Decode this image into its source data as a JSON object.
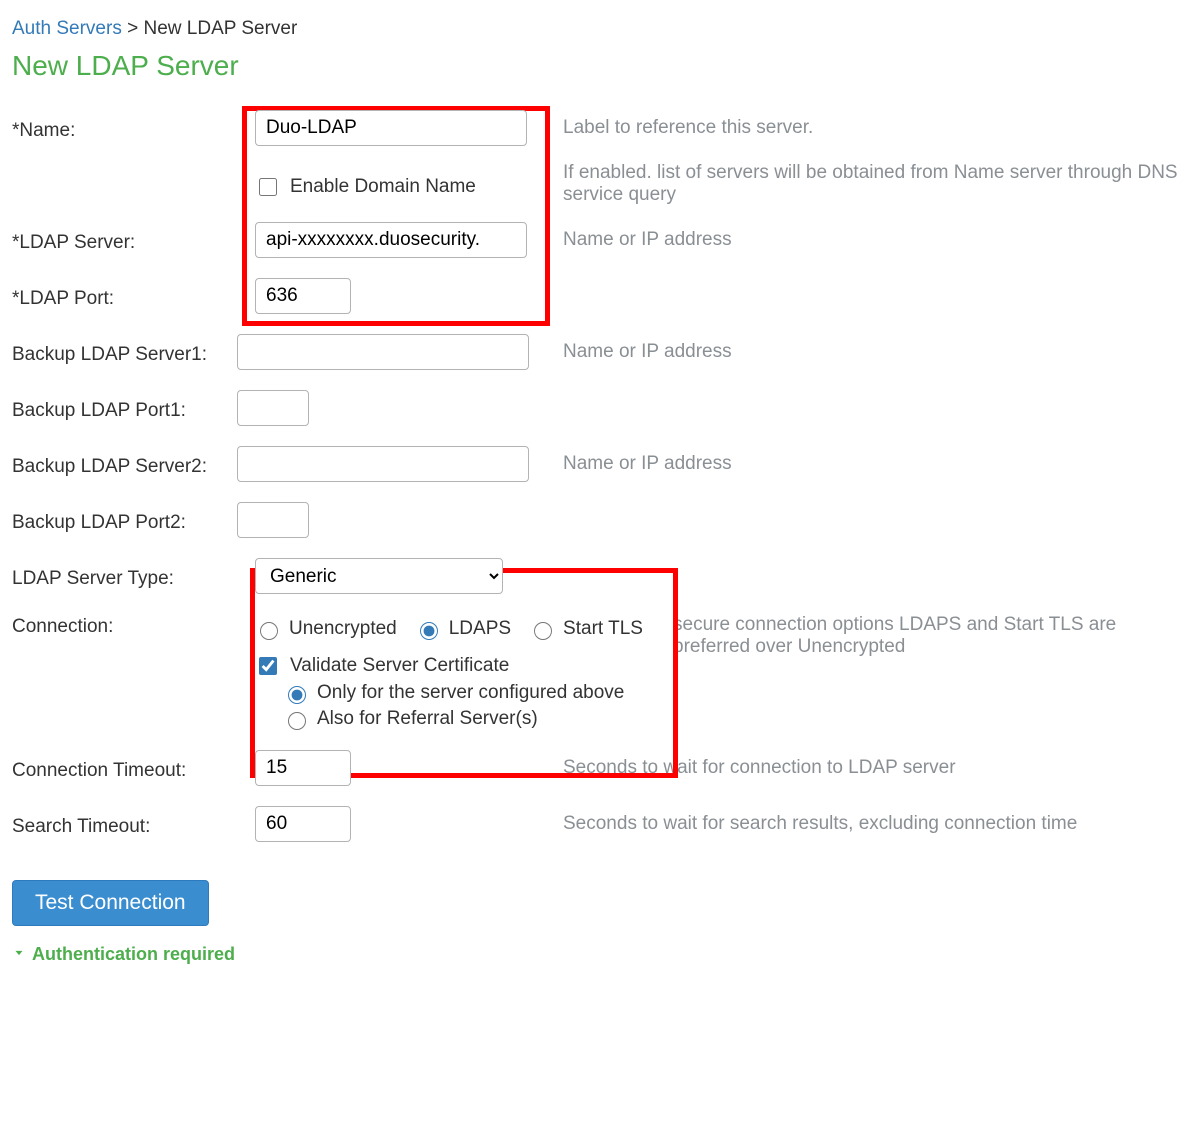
{
  "breadcrumb": {
    "parent": "Auth Servers",
    "sep": ">",
    "current": "New LDAP Server"
  },
  "title": "New LDAP Server",
  "fields": {
    "name": {
      "label": "*Name:",
      "value": "Duo-LDAP",
      "help": "Label to reference this server."
    },
    "enable_dns": {
      "label": "Enable Domain Name",
      "checked": false,
      "help": "If enabled. list of servers will be obtained from Name server through DNS service query"
    },
    "ldap_server": {
      "label": "*LDAP Server:",
      "value": "api-xxxxxxxx.duosecurity.",
      "help": "Name or IP address"
    },
    "ldap_port": {
      "label": "*LDAP Port:",
      "value": "636"
    },
    "bk1_server": {
      "label": "Backup LDAP Server1:",
      "value": "",
      "help": "Name or IP address"
    },
    "bk1_port": {
      "label": "Backup LDAP Port1:",
      "value": ""
    },
    "bk2_server": {
      "label": "Backup LDAP Server2:",
      "value": "",
      "help": "Name or IP address"
    },
    "bk2_port": {
      "label": "Backup LDAP Port2:",
      "value": ""
    },
    "server_type": {
      "label": "LDAP Server Type:",
      "value": "Generic",
      "options": [
        "Generic"
      ]
    },
    "connection": {
      "label": "Connection:",
      "options": {
        "unencrypted": "Unencrypted",
        "ldaps": "LDAPS",
        "starttls": "Start TLS"
      },
      "selected": "ldaps",
      "help": "secure connection options LDAPS and Start TLS are preferred over Unencrypted",
      "validate_label": "Validate Server Certificate",
      "validate_checked": true,
      "scope_only": "Only for the server configured above",
      "scope_referral": "Also for Referral Server(s)",
      "scope_selected": "only"
    },
    "conn_timeout": {
      "label": "Connection Timeout:",
      "value": "15",
      "help": "Seconds to wait for connection to LDAP server"
    },
    "search_timeout": {
      "label": "Search Timeout:",
      "value": "60",
      "help": "Seconds to wait for search results, excluding connection time"
    }
  },
  "buttons": {
    "test": "Test Connection"
  },
  "section": {
    "auth_required": "Authentication required"
  }
}
